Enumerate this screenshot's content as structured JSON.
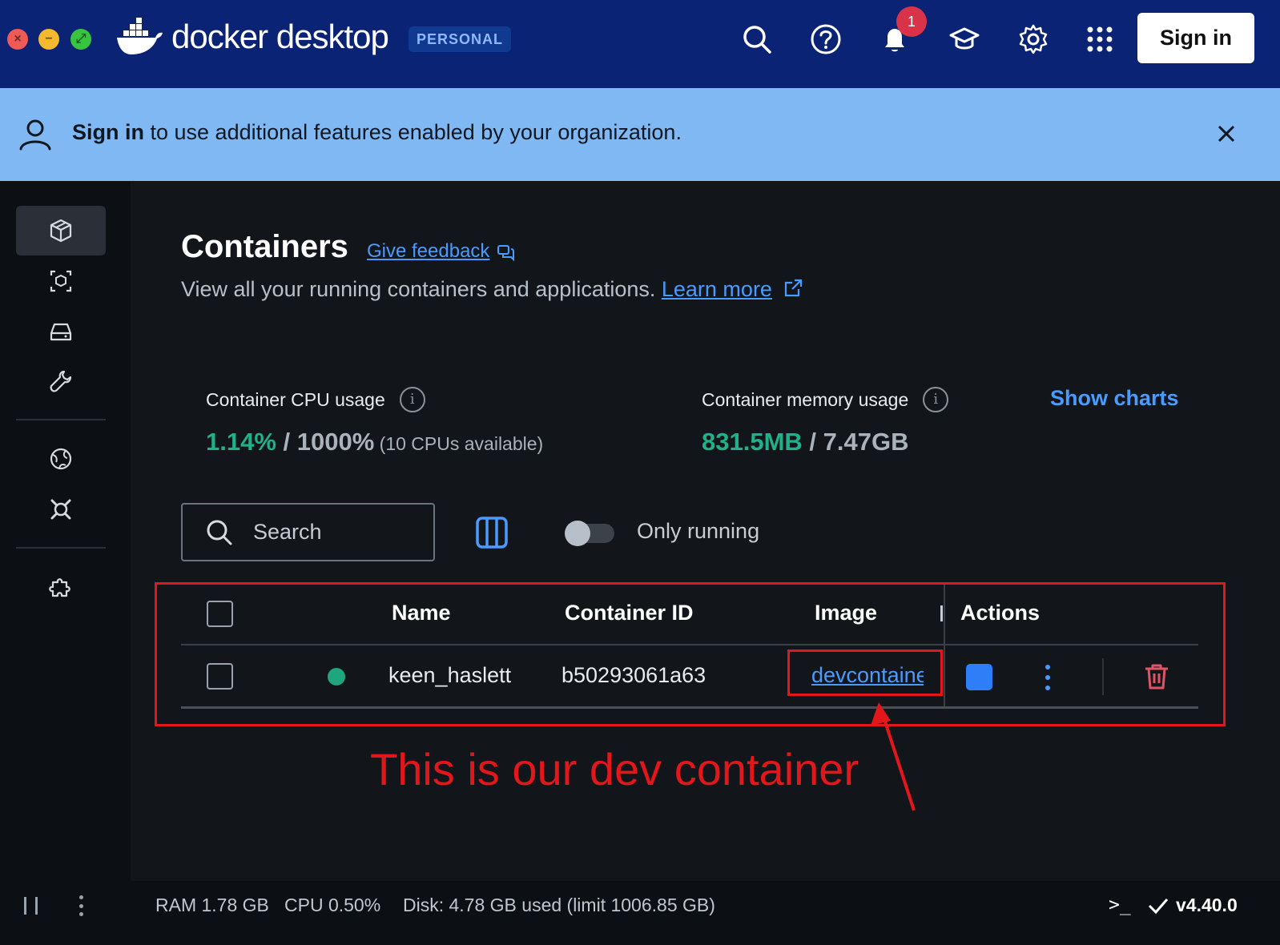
{
  "titlebar": {
    "brand": "docker desktop",
    "plan_badge": "PERSONAL",
    "notification_count": "1",
    "signin_label": "Sign in"
  },
  "banner": {
    "strong": "Sign in",
    "text": " to use additional features enabled by your organization."
  },
  "main": {
    "title": "Containers",
    "feedback": "Give feedback",
    "subtitle": "View all your running containers and applications. ",
    "learn_more": "Learn more"
  },
  "stats": {
    "cpu_label": "Container CPU usage",
    "cpu_used": "1.14%",
    "cpu_sep": " / ",
    "cpu_total": "1000%",
    "cpu_note": " (10 CPUs available)",
    "mem_label": "Container memory usage",
    "mem_used": "831.5MB",
    "mem_sep": " / ",
    "mem_total": "7.47GB",
    "show_charts": "Show charts"
  },
  "toolbar": {
    "search_placeholder": "Search",
    "only_running": "Only running"
  },
  "table": {
    "columns": [
      "Name",
      "Container ID",
      "Image",
      "Actions"
    ],
    "rows": [
      {
        "name": "keen_haslett",
        "id": "b50293061a63",
        "image": "devcontainer"
      }
    ]
  },
  "annotation": {
    "text": "This is our dev container",
    "color": "#e3161b"
  },
  "footer": {
    "ram": "RAM 1.78 GB",
    "cpu": "CPU 0.50%",
    "disk": "Disk: 4.78 GB used (limit 1006.85 GB)",
    "terminal": ">_",
    "version": "v4.40.0"
  },
  "colors": {
    "titlebar": "#0b2375",
    "banner": "#80b8f4",
    "accent": "#4a9bff",
    "running": "#1fa67e",
    "danger": "#d9334a"
  }
}
